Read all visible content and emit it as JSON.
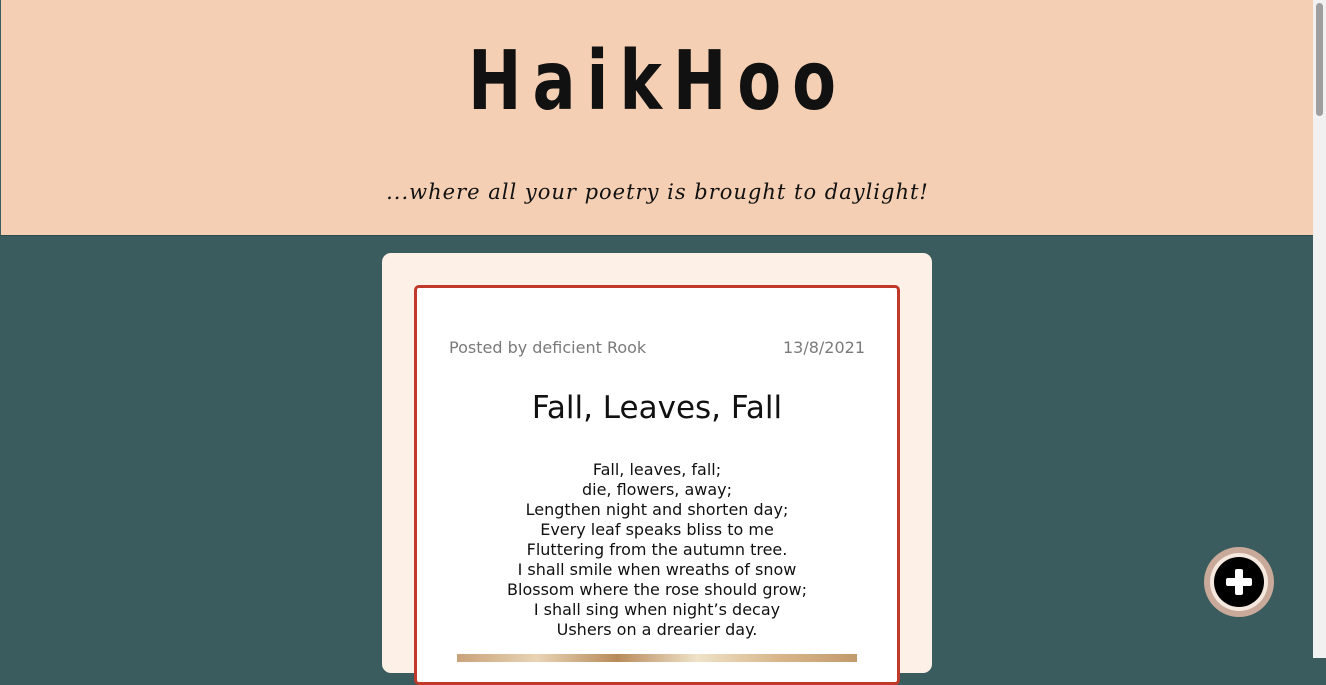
{
  "header": {
    "logo": "HaikHoo",
    "tagline": "...where all your poetry is brought to daylight!"
  },
  "post": {
    "author": "Posted by deficient Rook",
    "date": "13/8/2021",
    "title": "Fall, Leaves, Fall",
    "lines": [
      "Fall, leaves, fall;",
      "die, flowers, away;",
      "Lengthen night and shorten day;",
      "Every leaf speaks bliss to me",
      "Fluttering from the autumn tree.",
      "I shall smile when wreaths of snow",
      "Blossom where the rose should grow;",
      "I shall sing when night’s decay",
      "Ushers on a drearier day."
    ]
  },
  "fab": {
    "icon": "plus-icon"
  },
  "colors": {
    "header_bg": "#f4cfb3",
    "page_bg": "#3b5c5e",
    "card_bg": "#fdf0e7",
    "card_border": "#c0392b"
  }
}
